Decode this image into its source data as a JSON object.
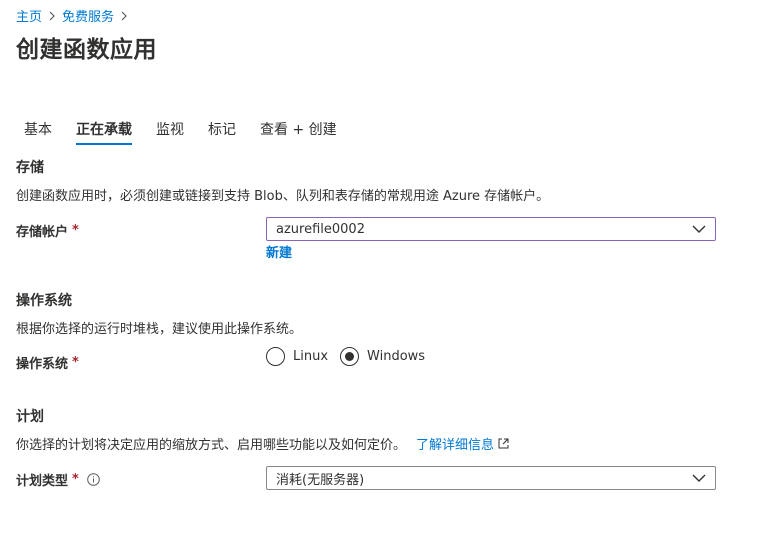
{
  "breadcrumb": {
    "items": [
      "主页",
      "免费服务"
    ]
  },
  "page": {
    "title": "创建函数应用"
  },
  "tabs": [
    {
      "label": "基本",
      "active": false
    },
    {
      "label": "正在承载",
      "active": true
    },
    {
      "label": "监视",
      "active": false
    },
    {
      "label": "标记",
      "active": false
    },
    {
      "label": "查看 + 创建",
      "active": false
    }
  ],
  "storage": {
    "title": "存储",
    "description": "创建函数应用时，必须创建或链接到支持 Blob、队列和表存储的常规用途 Azure 存储帐户。",
    "account_label": "存储帐户",
    "account_value": "azurefile0002",
    "create_new": "新建"
  },
  "os": {
    "title": "操作系统",
    "description": "根据你选择的运行时堆栈，建议使用此操作系统。",
    "label": "操作系统",
    "options": [
      {
        "label": "Linux",
        "selected": false
      },
      {
        "label": "Windows",
        "selected": true
      }
    ]
  },
  "plan": {
    "title": "计划",
    "description": "你选择的计划将决定应用的缩放方式、启用哪些功能以及如何定价。",
    "learn_more": "了解详细信息",
    "type_label": "计划类型",
    "type_value": "消耗(无服务器)"
  },
  "required_marker": "*",
  "colors": {
    "accent": "#0078d4",
    "required": "#a4262c",
    "text": "#323130",
    "focus_border": "#8764b8"
  }
}
